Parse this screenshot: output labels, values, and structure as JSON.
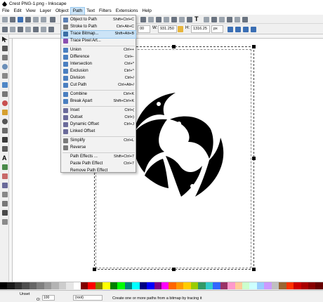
{
  "window": {
    "title": "Crest PNG-1.png - Inkscape"
  },
  "menubar": {
    "items": [
      {
        "label": "File"
      },
      {
        "label": "Edit"
      },
      {
        "label": "View"
      },
      {
        "label": "Layer"
      },
      {
        "label": "Object"
      },
      {
        "label": "Path"
      },
      {
        "label": "Text"
      },
      {
        "label": "Filters"
      },
      {
        "label": "Extensions"
      },
      {
        "label": "Help"
      }
    ]
  },
  "toolbar": {
    "zoom_value": "00",
    "w_label": "W:",
    "w_value": "931.250",
    "h_label": "H:",
    "h_value": "1316.25",
    "unit": "px"
  },
  "path_menu": {
    "items": [
      {
        "label": "Object to Path",
        "shortcut": "Shift+Ctrl+C",
        "icon": "object-to-path-icon"
      },
      {
        "label": "Stroke to Path",
        "shortcut": "Ctrl+Alt+C",
        "icon": "stroke-to-path-icon"
      },
      {
        "label": "Trace Bitmap...",
        "shortcut": "Shift+Alt+B",
        "icon": "trace-bitmap-icon"
      },
      {
        "label": "Trace Pixel Art...",
        "shortcut": "",
        "icon": "trace-pixel-art-icon"
      },
      {
        "label": "Union",
        "shortcut": "Ctrl++",
        "icon": "union-icon"
      },
      {
        "label": "Difference",
        "shortcut": "Ctrl+-",
        "icon": "difference-icon"
      },
      {
        "label": "Intersection",
        "shortcut": "Ctrl+*",
        "icon": "intersection-icon"
      },
      {
        "label": "Exclusion",
        "shortcut": "Ctrl+^",
        "icon": "exclusion-icon"
      },
      {
        "label": "Division",
        "shortcut": "Ctrl+/",
        "icon": "division-icon"
      },
      {
        "label": "Cut Path",
        "shortcut": "Ctrl+Alt+/",
        "icon": "cut-path-icon"
      },
      {
        "label": "Combine",
        "shortcut": "Ctrl+K",
        "icon": "combine-icon"
      },
      {
        "label": "Break Apart",
        "shortcut": "Shift+Ctrl+K",
        "icon": "break-apart-icon"
      },
      {
        "label": "Inset",
        "shortcut": "Ctrl+(",
        "icon": "inset-icon"
      },
      {
        "label": "Outset",
        "shortcut": "Ctrl+)",
        "icon": "outset-icon"
      },
      {
        "label": "Dynamic Offset",
        "shortcut": "Ctrl+J",
        "icon": "dynamic-offset-icon"
      },
      {
        "label": "Linked Offset",
        "shortcut": "",
        "icon": "linked-offset-icon"
      },
      {
        "label": "Simplify",
        "shortcut": "Ctrl+L",
        "icon": "simplify-icon"
      },
      {
        "label": "Reverse",
        "shortcut": "",
        "icon": "reverse-icon"
      },
      {
        "label": "Path Effects ...",
        "shortcut": "Shift+Ctrl+7",
        "icon": ""
      },
      {
        "label": "Paste Path Effect",
        "shortcut": "Ctrl+7",
        "icon": ""
      },
      {
        "label": "Remove Path Effect",
        "shortcut": "",
        "icon": ""
      }
    ],
    "highlighted": "Trace Bitmap..."
  },
  "statusbar": {
    "fill_label": "Unset",
    "opacity_label": "O:",
    "opacity_value": "100",
    "layer_value": "(root)",
    "message": "Create one or more paths from a bitmap by tracing it"
  },
  "palette_colors": [
    "#000000",
    "#1a1a1a",
    "#333333",
    "#4d4d4d",
    "#666666",
    "#808080",
    "#999999",
    "#b3b3b3",
    "#cccccc",
    "#e6e6e6",
    "#ffffff",
    "#800000",
    "#ff0000",
    "#808000",
    "#ffff00",
    "#008000",
    "#00ff00",
    "#008080",
    "#00ffff",
    "#000080",
    "#0000ff",
    "#800080",
    "#ff00ff",
    "#ff6600",
    "#ff9900",
    "#ffcc00",
    "#99cc00",
    "#339966",
    "#33cccc",
    "#3366ff",
    "#993366",
    "#ff99cc",
    "#ffcc99",
    "#ccffcc",
    "#ccffff",
    "#99ccff",
    "#cc99ff",
    "#c0c0c0",
    "#996633",
    "#ff3300",
    "#cc0000",
    "#aa0000",
    "#880000",
    "#660000"
  ]
}
